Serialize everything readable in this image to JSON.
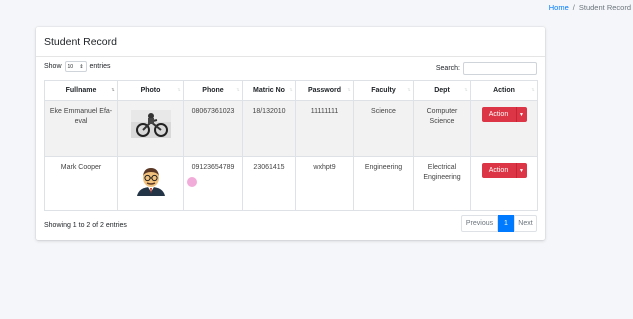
{
  "breadcrumb": {
    "home": "Home",
    "separator": "/",
    "current": "Student Record"
  },
  "card": {
    "title": "Student Record"
  },
  "controls": {
    "show": "Show",
    "length_value": "10",
    "entries": "entries",
    "search_label": "Search:",
    "search_value": ""
  },
  "table": {
    "headers": [
      "Fullname",
      "Photo",
      "Phone",
      "Matric No",
      "Password",
      "Faculty",
      "Dept",
      "Action"
    ],
    "rows": [
      {
        "fullname": "Eke Emmanuel Efa-eval",
        "photo": "photo-motorbike",
        "phone": "08067361023",
        "matric": "18/132010",
        "password": "11111111",
        "faculty": "Science",
        "dept": "Computer Science",
        "action": "Action"
      },
      {
        "fullname": "Mark Cooper",
        "photo": "photo-avatar-glasses",
        "phone": "09123654789",
        "matric": "23061415",
        "password": "wxhpt9",
        "faculty": "Engineering",
        "dept": "Electrical Engineering",
        "action": "Action"
      }
    ]
  },
  "footer": {
    "info": "Showing 1 to 2 of 2 entries",
    "previous": "Previous",
    "page": "1",
    "next": "Next"
  },
  "colors": {
    "primary": "#007bff",
    "danger": "#dc3545",
    "background": "#f4f6f9"
  }
}
